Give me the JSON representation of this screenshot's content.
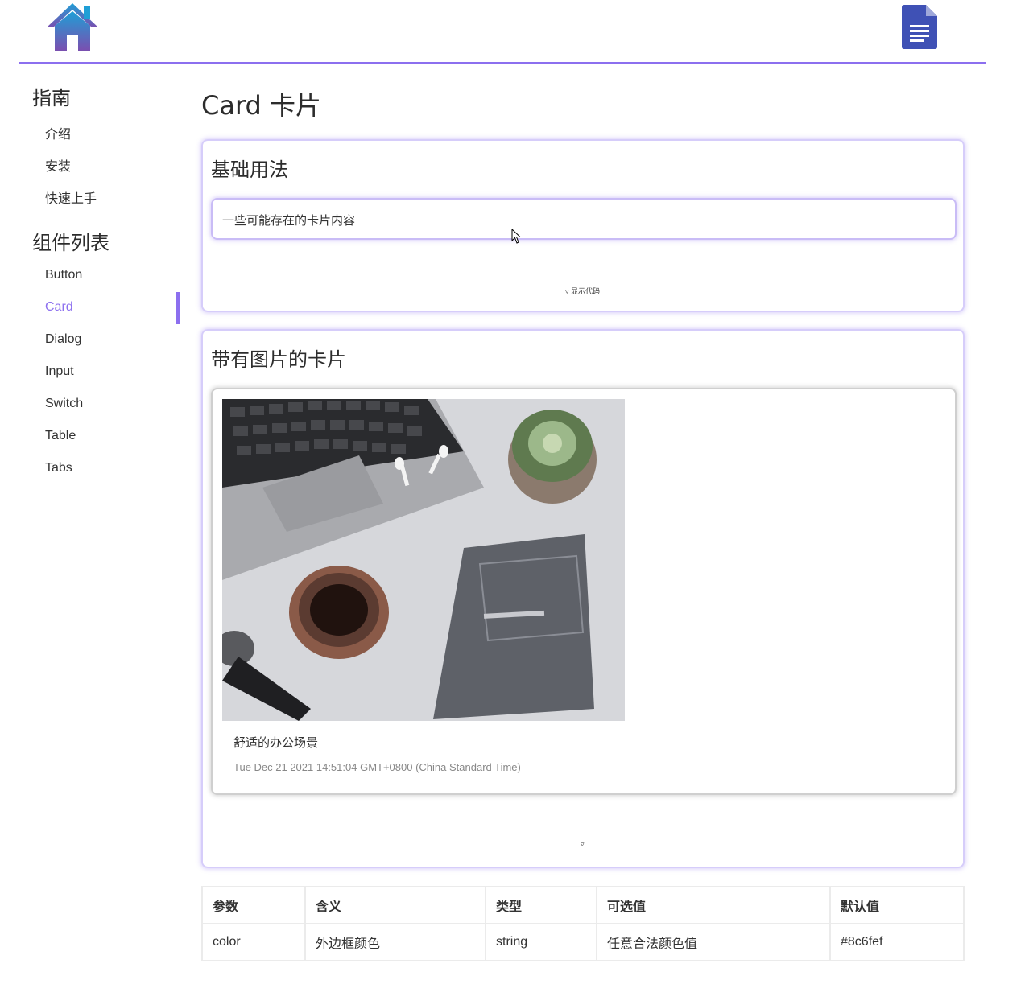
{
  "header": {
    "home_icon": "home-icon",
    "doc_icon": "document-icon",
    "accent_color": "#8c6fef"
  },
  "sidebar": {
    "groups": [
      {
        "title": "指南",
        "items": [
          {
            "label": "介绍"
          },
          {
            "label": "安装"
          },
          {
            "label": "快速上手"
          }
        ]
      },
      {
        "title": "组件列表",
        "items": [
          {
            "label": "Button"
          },
          {
            "label": "Card",
            "active": true
          },
          {
            "label": "Dialog"
          },
          {
            "label": "Input"
          },
          {
            "label": "Switch"
          },
          {
            "label": "Table"
          },
          {
            "label": "Tabs"
          }
        ]
      }
    ]
  },
  "main": {
    "title": "Card 卡片",
    "demos": [
      {
        "title": "基础用法",
        "card_content": "一些可能存在的卡片内容",
        "toggle": "▿ 显示代码"
      },
      {
        "title": "带有图片的卡片",
        "image_caption": "舒适的办公场景",
        "image_time": "Tue Dec 21 2021 14:51:04 GMT+0800 (China Standard Time)",
        "toggle": "▿"
      }
    ],
    "props_table": {
      "headers": [
        "参数",
        "含义",
        "类型",
        "可选值",
        "默认值"
      ],
      "rows": [
        [
          "color",
          "外边框颜色",
          "string",
          "任意合法颜色值",
          "#8c6fef"
        ]
      ]
    }
  }
}
